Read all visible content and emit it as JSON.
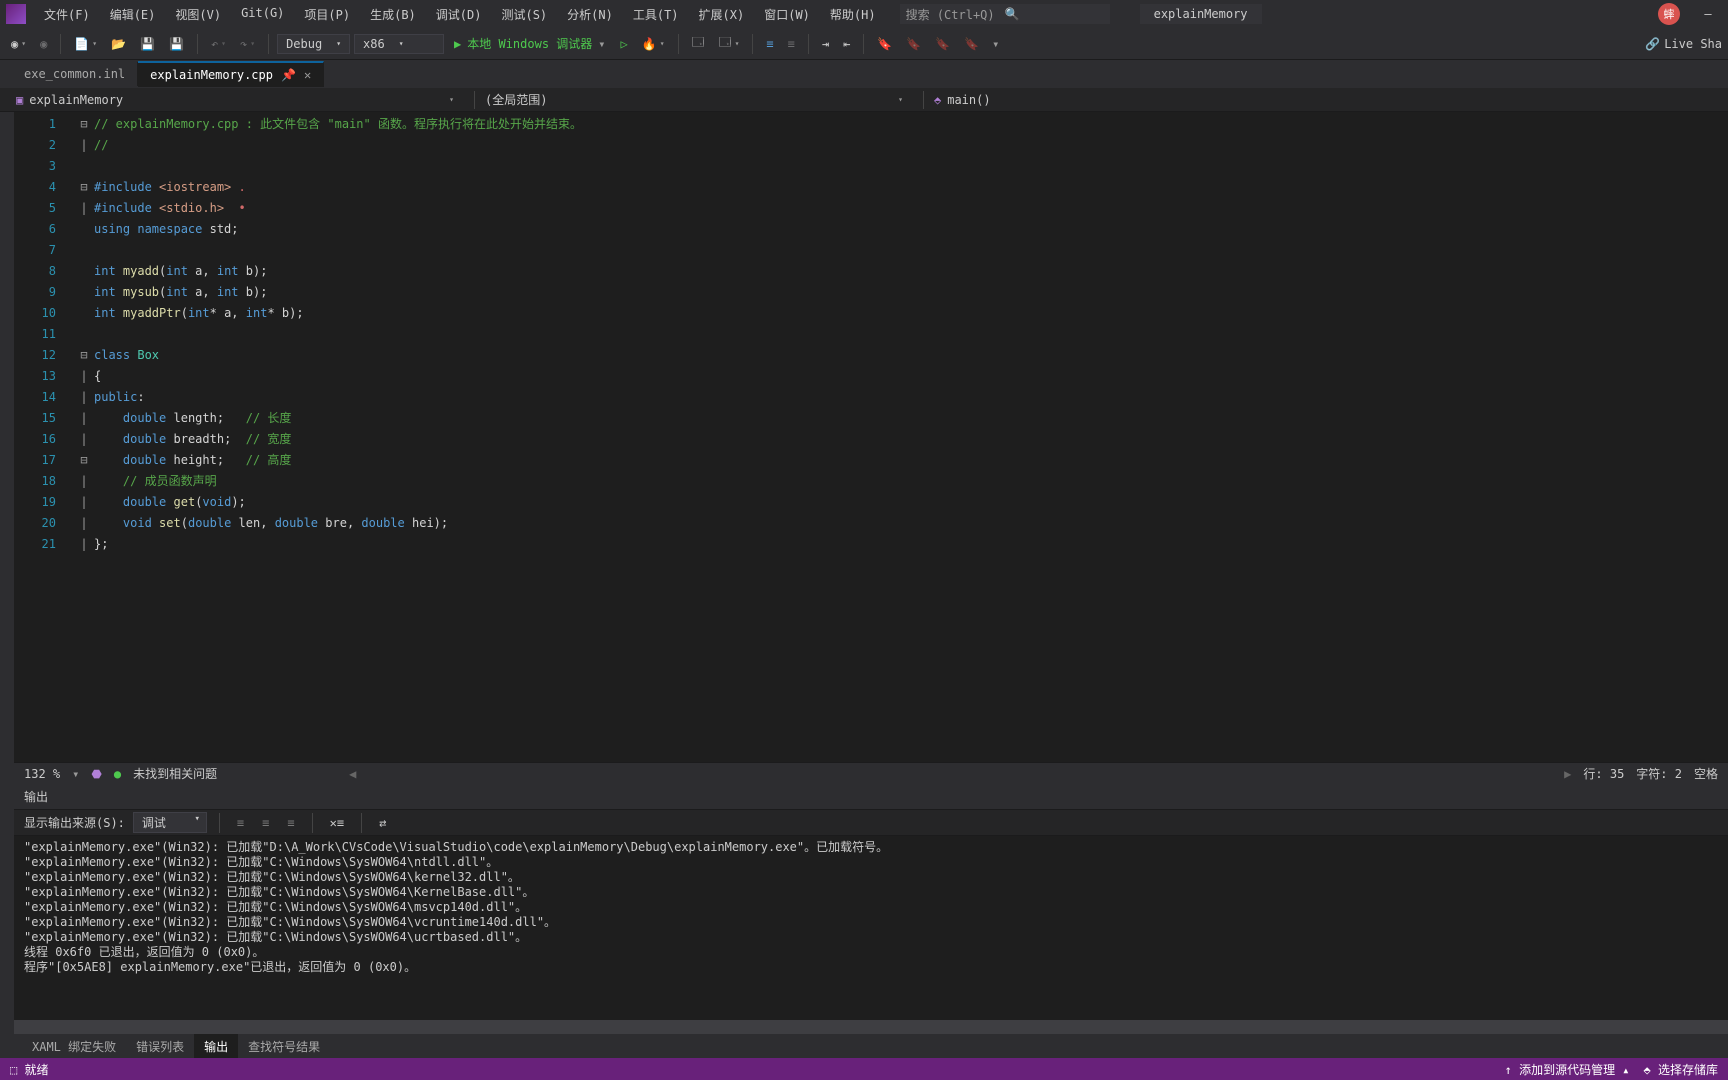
{
  "menu": {
    "items": [
      "文件(F)",
      "编辑(E)",
      "视图(V)",
      "Git(G)",
      "项目(P)",
      "生成(B)",
      "调试(D)",
      "测试(S)",
      "分析(N)",
      "工具(T)",
      "扩展(X)",
      "窗口(W)",
      "帮助(H)"
    ],
    "search_placeholder": "搜索 (Ctrl+Q)",
    "project": "explainMemory",
    "user_initial": "蟀",
    "minimize": "—"
  },
  "toolbar": {
    "config": "Debug",
    "platform": "x86",
    "run": "本地 Windows 调试器",
    "live": "Live Sha"
  },
  "tabs": {
    "inactive": "exe_common.inl",
    "active": "explainMemory.cpp"
  },
  "nav": {
    "scope": "explainMemory",
    "global": "(全局范围)",
    "func": "main()"
  },
  "code": {
    "lines": [
      {
        "n": 1,
        "fold": "⊟",
        "tokens": [
          [
            "comment",
            "// explainMemory.cpp : 此文件包含 \"main\" 函数。程序执行将在此处开始并结束。"
          ]
        ]
      },
      {
        "n": 2,
        "fold": "|",
        "tokens": [
          [
            "comment",
            "//"
          ]
        ]
      },
      {
        "n": 3,
        "fold": "",
        "tokens": []
      },
      {
        "n": 4,
        "fold": "⊟",
        "tokens": [
          [
            "keyword",
            "#include "
          ],
          [
            "string",
            "<iostream>"
          ],
          [
            "red",
            " ."
          ]
        ]
      },
      {
        "n": 5,
        "fold": "|",
        "tokens": [
          [
            "keyword",
            "#include "
          ],
          [
            "string",
            "<stdio.h>"
          ],
          [
            "red",
            "  •"
          ]
        ]
      },
      {
        "n": 6,
        "fold": "",
        "tokens": [
          [
            "keyword",
            "using namespace "
          ],
          [
            "plain",
            "std;"
          ]
        ]
      },
      {
        "n": 7,
        "fold": "",
        "tokens": []
      },
      {
        "n": 8,
        "fold": "",
        "tokens": [
          [
            "type",
            "int "
          ],
          [
            "func",
            "myadd"
          ],
          [
            "plain",
            "("
          ],
          [
            "type",
            "int"
          ],
          [
            "plain",
            " a, "
          ],
          [
            "type",
            "int"
          ],
          [
            "plain",
            " b);"
          ]
        ]
      },
      {
        "n": 9,
        "fold": "",
        "tokens": [
          [
            "type",
            "int "
          ],
          [
            "func",
            "mysub"
          ],
          [
            "plain",
            "("
          ],
          [
            "type",
            "int"
          ],
          [
            "plain",
            " a, "
          ],
          [
            "type",
            "int"
          ],
          [
            "plain",
            " b);"
          ]
        ]
      },
      {
        "n": 10,
        "fold": "",
        "tokens": [
          [
            "type",
            "int "
          ],
          [
            "func",
            "myaddPtr"
          ],
          [
            "plain",
            "("
          ],
          [
            "type",
            "int"
          ],
          [
            "plain",
            "* a, "
          ],
          [
            "type",
            "int"
          ],
          [
            "plain",
            "* b);"
          ]
        ]
      },
      {
        "n": 11,
        "fold": "",
        "tokens": []
      },
      {
        "n": 12,
        "fold": "⊟",
        "tokens": [
          [
            "keyword",
            "class "
          ],
          [
            "class",
            "Box"
          ]
        ]
      },
      {
        "n": 13,
        "fold": "|",
        "tokens": [
          [
            "plain",
            "{"
          ]
        ]
      },
      {
        "n": 14,
        "fold": "|",
        "tokens": [
          [
            "keyword",
            "public"
          ],
          [
            "plain",
            ":"
          ]
        ]
      },
      {
        "n": 15,
        "fold": "|",
        "tokens": [
          [
            "plain",
            "    "
          ],
          [
            "type",
            "double"
          ],
          [
            "plain",
            " length;   "
          ],
          [
            "comment",
            "// 长度"
          ]
        ]
      },
      {
        "n": 16,
        "fold": "|",
        "tokens": [
          [
            "plain",
            "    "
          ],
          [
            "type",
            "double"
          ],
          [
            "plain",
            " breadth;  "
          ],
          [
            "comment",
            "// 宽度"
          ]
        ]
      },
      {
        "n": 17,
        "fold": "⊟",
        "tokens": [
          [
            "plain",
            "    "
          ],
          [
            "type",
            "double"
          ],
          [
            "plain",
            " height;   "
          ],
          [
            "comment",
            "// 高度"
          ]
        ]
      },
      {
        "n": 18,
        "fold": "|",
        "tokens": [
          [
            "plain",
            "    "
          ],
          [
            "comment",
            "// 成员函数声明"
          ]
        ]
      },
      {
        "n": 19,
        "fold": "|",
        "tokens": [
          [
            "plain",
            "    "
          ],
          [
            "type",
            "double"
          ],
          [
            "plain",
            " "
          ],
          [
            "func",
            "get"
          ],
          [
            "plain",
            "("
          ],
          [
            "type",
            "void"
          ],
          [
            "plain",
            ");"
          ]
        ]
      },
      {
        "n": 20,
        "fold": "|",
        "tokens": [
          [
            "plain",
            "    "
          ],
          [
            "type",
            "void"
          ],
          [
            "plain",
            " "
          ],
          [
            "func",
            "set"
          ],
          [
            "plain",
            "("
          ],
          [
            "type",
            "double"
          ],
          [
            "plain",
            " len, "
          ],
          [
            "type",
            "double"
          ],
          [
            "plain",
            " bre, "
          ],
          [
            "type",
            "double"
          ],
          [
            "plain",
            " hei);"
          ]
        ]
      },
      {
        "n": 21,
        "fold": "|",
        "tokens": [
          [
            "plain",
            "};"
          ]
        ]
      }
    ]
  },
  "editor_status": {
    "zoom": "132 %",
    "issues": "未找到相关问题",
    "line": "行: 35",
    "char": "字符: 2",
    "mode": "空格"
  },
  "output": {
    "title": "输出",
    "source_label": "显示输出来源(S):",
    "source_value": "调试",
    "lines": [
      "\"explainMemory.exe\"(Win32): 已加载\"D:\\A_Work\\CVsCode\\VisualStudio\\code\\explainMemory\\Debug\\explainMemory.exe\"。已加载符号。",
      "\"explainMemory.exe\"(Win32): 已加载\"C:\\Windows\\SysWOW64\\ntdll.dll\"。",
      "\"explainMemory.exe\"(Win32): 已加载\"C:\\Windows\\SysWOW64\\kernel32.dll\"。",
      "\"explainMemory.exe\"(Win32): 已加载\"C:\\Windows\\SysWOW64\\KernelBase.dll\"。",
      "\"explainMemory.exe\"(Win32): 已加载\"C:\\Windows\\SysWOW64\\msvcp140d.dll\"。",
      "\"explainMemory.exe\"(Win32): 已加载\"C:\\Windows\\SysWOW64\\vcruntime140d.dll\"。",
      "\"explainMemory.exe\"(Win32): 已加载\"C:\\Windows\\SysWOW64\\ucrtbased.dll\"。",
      "线程 0x6f0 已退出，返回值为 0 (0x0)。",
      "程序\"[0x5AE8] explainMemory.exe\"已退出，返回值为 0 (0x0)。"
    ]
  },
  "bottom_tabs": [
    "XAML 绑定失败",
    "错误列表",
    "输出",
    "查找符号结果"
  ],
  "statusbar": {
    "ready": "就绪",
    "add_source": "添加到源代码管理",
    "select_repo": "选择存储库"
  }
}
